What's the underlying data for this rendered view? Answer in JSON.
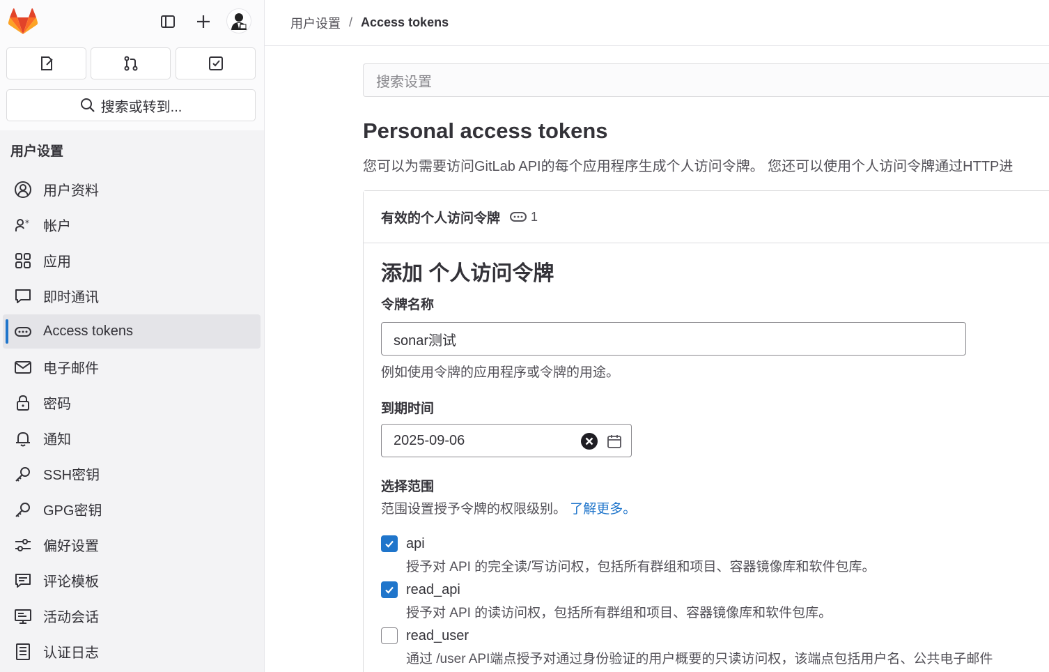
{
  "sidebar": {
    "search_label": "搜索或转到...",
    "heading": "用户设置",
    "items": [
      {
        "label": "用户资料",
        "icon": "profile-icon"
      },
      {
        "label": "帐户",
        "icon": "account-icon"
      },
      {
        "label": "应用",
        "icon": "applications-icon"
      },
      {
        "label": "即时通讯",
        "icon": "chat-icon"
      },
      {
        "label": "Access tokens",
        "icon": "token-icon",
        "active": true
      },
      {
        "label": "电子邮件",
        "icon": "mail-icon"
      },
      {
        "label": "密码",
        "icon": "lock-icon"
      },
      {
        "label": "通知",
        "icon": "bell-icon"
      },
      {
        "label": "SSH密钥",
        "icon": "key-icon"
      },
      {
        "label": "GPG密钥",
        "icon": "key-icon"
      },
      {
        "label": "偏好设置",
        "icon": "preferences-icon"
      },
      {
        "label": "评论模板",
        "icon": "comment-template-icon"
      },
      {
        "label": "活动会话",
        "icon": "monitor-icon"
      },
      {
        "label": "认证日志",
        "icon": "log-icon"
      }
    ]
  },
  "breadcrumb": {
    "parent": "用户设置",
    "separator": "/",
    "current": "Access tokens"
  },
  "main": {
    "search_placeholder": "搜索设置",
    "title": "Personal access tokens",
    "description": "您可以为需要访问GitLab API的每个应用程序生成个人访问令牌。 您还可以使用个人访问令牌通过HTTP进",
    "card": {
      "heading": "有效的个人访问令牌",
      "count": "1"
    },
    "form": {
      "title": "添加 个人访问令牌",
      "name_label": "令牌名称",
      "name_value": "sonar测试",
      "name_help": "例如使用令牌的应用程序或令牌的用途。",
      "expiry_label": "到期时间",
      "expiry_value": "2025-09-06",
      "scopes_label": "选择范围",
      "scopes_help": "范围设置授予令牌的权限级别。",
      "scopes_link": "了解更多。",
      "scopes": [
        {
          "name": "api",
          "checked": true,
          "desc": "授予对 API 的完全读/写访问权，包括所有群组和项目、容器镜像库和软件包库。"
        },
        {
          "name": "read_api",
          "checked": true,
          "desc": "授予对 API 的读访问权，包括所有群组和项目、容器镜像库和软件包库。"
        },
        {
          "name": "read_user",
          "checked": false,
          "desc": "通过 /user API端点授予对通过身份验证的用户概要的只读访问权，该端点包括用户名、公共电子邮件"
        }
      ]
    }
  },
  "colors": {
    "accent": "#1f75cb",
    "sidebar_bg": "#f3f3f5",
    "logo_orange": "#e24329"
  }
}
